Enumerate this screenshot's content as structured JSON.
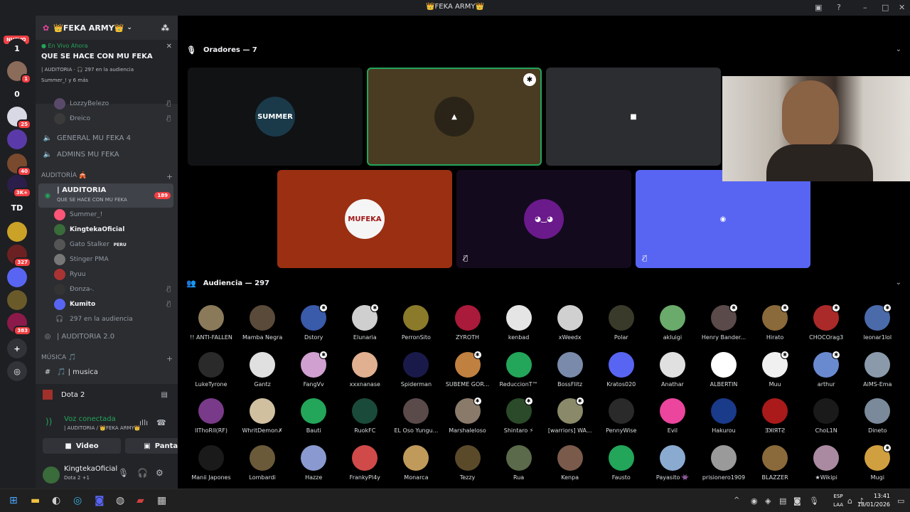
{
  "window": {
    "title": "👑FEKA ARMY👑"
  },
  "guilds": {
    "nuevo": "NUEVO",
    "items": [
      {
        "label": "1",
        "bg": "#1e1f22",
        "badge": ""
      },
      {
        "label": "",
        "bg": "#8b6b5a",
        "badge": "1"
      },
      {
        "label": "0",
        "bg": "#1e1f22",
        "badge": ""
      },
      {
        "label": "",
        "bg": "#d9d9e6",
        "badge": "25"
      },
      {
        "label": "",
        "bg": "#5a3aa8",
        "badge": ""
      },
      {
        "label": "",
        "bg": "#7a4a2e",
        "badge": "40"
      },
      {
        "label": "",
        "bg": "#2c1e4a",
        "badge": "3K+"
      },
      {
        "label": "TD",
        "bg": "#1e1f22",
        "badge": ""
      },
      {
        "label": "",
        "bg": "#c9a227",
        "badge": ""
      },
      {
        "label": "",
        "bg": "#6b2121",
        "badge": "327"
      },
      {
        "label": "",
        "bg": "#5865f2",
        "badge": ""
      },
      {
        "label": "",
        "bg": "#6a5a2a",
        "badge": ""
      },
      {
        "label": "",
        "bg": "#8b1a4a",
        "badge": "383"
      },
      {
        "label": "+",
        "bg": "#313338",
        "badge": ""
      },
      {
        "label": "◎",
        "bg": "#313338",
        "badge": ""
      }
    ]
  },
  "server": {
    "name": "👑FEKA ARMY👑"
  },
  "live": {
    "status": "En Vivo Ahora",
    "title": "QUE SE HACE CON MU FEKA",
    "meta": "| AUDITORIA · 🎧 297 en la audiencia",
    "users": "Summer_! y 6 más"
  },
  "channel_list": {
    "top_users": [
      "LozzyBelezo",
      "Ðreico"
    ],
    "voice_channels": [
      "GENERAL MU FEKA 4",
      "ADMINS MU FEKA"
    ],
    "category": "AUDITORÍA 🎪",
    "active": {
      "name": "| AUDITORIA",
      "sub": "QUE SE HACE CON MU FEKA",
      "badge": "189"
    },
    "members": [
      {
        "name": "Summer_!",
        "color": "#ff5577"
      },
      {
        "name": "KingtekaOficial",
        "color": "#3a6b3a"
      },
      {
        "name": "Gato Stalker",
        "color": "#555",
        "tag": "PERU"
      },
      {
        "name": "Stinger PMA",
        "color": "#777"
      },
      {
        "name": "Ryuu",
        "color": "#a33"
      },
      {
        "name": "Ɖonza-.",
        "color": "#333"
      },
      {
        "name": "Kumito",
        "color": "#5865f2"
      }
    ],
    "audience_line": "297 en la audiencia",
    "other_channel": "| AUDITORIA 2.0",
    "music_category": "MÚSICA 🎵",
    "music_channel": "🎵 | musica"
  },
  "activity": {
    "game": "Dota 2"
  },
  "voice": {
    "status": "Voz conectada",
    "location": "| AUDITORIA / 👑FEKA ARMY👑",
    "video_label": "Video",
    "screen_label": "Pantalla"
  },
  "user": {
    "name": "KingtekaOficial",
    "sub": "Dota 2 +1"
  },
  "speakers": {
    "header": "Oradores — 7",
    "tiles": [
      {
        "label": "SUMMER",
        "bg": "#111214",
        "avbg": "#1a3a4a",
        "muted": false,
        "badge": false,
        "speaking": false
      },
      {
        "label": "▲",
        "bg": "#4a3c22",
        "avbg": "#2a2418",
        "muted": false,
        "badge": true,
        "speaking": true
      },
      {
        "label": "■",
        "bg": "#2b2d31",
        "avbg": "#2b2d31",
        "muted": false,
        "badge": false,
        "speaking": false
      },
      {
        "label": "MUFEKA",
        "bg": "#9b2f12",
        "avbg": "#f5f5f5",
        "muted": false,
        "badge": false,
        "speaking": false
      },
      {
        "label": "◕‿◕",
        "bg": "#140a1e",
        "avbg": "#6a1a8a",
        "muted": true,
        "badge": false,
        "speaking": false
      },
      {
        "label": "◉",
        "bg": "#5865f2",
        "avbg": "#5865f2",
        "muted": true,
        "badge": false,
        "speaking": false
      }
    ]
  },
  "audience": {
    "header": "Audiencia — 297",
    "members": [
      {
        "name": "!! ANTI-FALLEN",
        "bg": "#8a7a5a",
        "mod": false
      },
      {
        "name": "Mamba Negra",
        "bg": "#5a4a3a",
        "mod": false
      },
      {
        "name": "Dstory",
        "bg": "#3a5aaa",
        "mod": true
      },
      {
        "name": "Elunaria",
        "bg": "#cfcfcf",
        "mod": true
      },
      {
        "name": "PerronSito",
        "bg": "#8a7a2a",
        "mod": false
      },
      {
        "name": "ZYROTH",
        "bg": "#aa1a3a",
        "mod": false
      },
      {
        "name": "kenbad",
        "bg": "#e5e5e5",
        "mod": false
      },
      {
        "name": "xWeedx",
        "bg": "#d0d0d0",
        "mod": false
      },
      {
        "name": "Polar",
        "bg": "#3a3a2a",
        "mod": false
      },
      {
        "name": "akluigi",
        "bg": "#6aaa6a",
        "mod": false
      },
      {
        "name": "Henry Bander...",
        "bg": "#5a4a4a",
        "mod": true
      },
      {
        "name": "Hirato",
        "bg": "#8a6a3a",
        "mod": true
      },
      {
        "name": "CHOCOrag3",
        "bg": "#aa2a2a",
        "mod": true
      },
      {
        "name": "leonar1lol",
        "bg": "#4a6aaa",
        "mod": true
      },
      {
        "name": "LukeTyrone",
        "bg": "#2a2a2a",
        "mod": false
      },
      {
        "name": "Gantz",
        "bg": "#e0e0e0",
        "mod": false
      },
      {
        "name": "FangVv",
        "bg": "#d0a0d0",
        "mod": true
      },
      {
        "name": "xxxnanase",
        "bg": "#e0b090",
        "mod": false
      },
      {
        "name": "Spiderman",
        "bg": "#1a1a4a",
        "mod": false
      },
      {
        "name": "SUBEME GOR...",
        "bg": "#c08040",
        "mod": true
      },
      {
        "name": "ReduccionT™",
        "bg": "#23a55a",
        "mod": false
      },
      {
        "name": "BossFlitz",
        "bg": "#7a8aaa",
        "mod": false
      },
      {
        "name": "Kratos020",
        "bg": "#5865f2",
        "mod": false
      },
      {
        "name": "Anathar",
        "bg": "#e0e0e0",
        "mod": false
      },
      {
        "name": "ALBERTIN",
        "bg": "#ffffff",
        "mod": false
      },
      {
        "name": "Muu",
        "bg": "#f0f0f0",
        "mod": true
      },
      {
        "name": "arthur",
        "bg": "#6a8ad0",
        "mod": true
      },
      {
        "name": "AiMS-Ema",
        "bg": "#8a9aaa",
        "mod": false
      },
      {
        "name": "lIThoRlI(RF)",
        "bg": "#7a3a8a",
        "mod": false
      },
      {
        "name": "WhritDemon✗",
        "bg": "#d0c0a0",
        "mod": false
      },
      {
        "name": "Bauti",
        "bg": "#23a55a",
        "mod": false
      },
      {
        "name": "RuokFC",
        "bg": "#1a4a3a",
        "mod": false
      },
      {
        "name": "EL Oso Yungu...",
        "bg": "#5a4a4a",
        "mod": false
      },
      {
        "name": "Marshaleloso",
        "bg": "#8a7a6a",
        "mod": true
      },
      {
        "name": "Shintaro ⚡",
        "bg": "#2a4a2a",
        "mod": true
      },
      {
        "name": "[warriors] WA...",
        "bg": "#8a8a6a",
        "mod": true
      },
      {
        "name": "PennyWise",
        "bg": "#2a2a2a",
        "mod": false
      },
      {
        "name": "Evil",
        "bg": "#eb459e",
        "mod": false
      },
      {
        "name": "Hakurou",
        "bg": "#1a3a8a",
        "mod": false
      },
      {
        "name": "ƎꓘIЯTƧ",
        "bg": "#aa1a1a",
        "mod": false
      },
      {
        "name": "ChoL1N",
        "bg": "#1a1a1a",
        "mod": false
      },
      {
        "name": "Dineto",
        "bg": "#7a8a9a",
        "mod": false
      },
      {
        "name": "Manii Japones",
        "bg": "#1a1a1a",
        "mod": false
      },
      {
        "name": "Lombardi",
        "bg": "#6a5a3a",
        "mod": false
      },
      {
        "name": "Hazze",
        "bg": "#8a9ad0",
        "mod": false
      },
      {
        "name": "FrankyPl4y",
        "bg": "#d04a4a",
        "mod": false
      },
      {
        "name": "Monarca",
        "bg": "#c09a5a",
        "mod": false
      },
      {
        "name": "Tezzy",
        "bg": "#5a4a2a",
        "mod": false
      },
      {
        "name": "Rua",
        "bg": "#5a6a4a",
        "mod": false
      },
      {
        "name": "Kenpa",
        "bg": "#7a5a4a",
        "mod": false
      },
      {
        "name": "Fausto",
        "bg": "#23a55a",
        "mod": false
      },
      {
        "name": "Payasito 👾",
        "bg": "#8aaad0",
        "mod": false
      },
      {
        "name": "prisionero1909",
        "bg": "#9a9a9a",
        "mod": false
      },
      {
        "name": "BLAZZER",
        "bg": "#8a6a3a",
        "mod": false
      },
      {
        "name": "★Wikipi",
        "bg": "#aa8aa0",
        "mod": false
      },
      {
        "name": "Mugi",
        "bg": "#d0a040",
        "mod": true
      }
    ]
  },
  "taskbar": {
    "lang1": "ESP",
    "lang2": "LAA",
    "time": "13:41",
    "date": "18/01/2026"
  }
}
